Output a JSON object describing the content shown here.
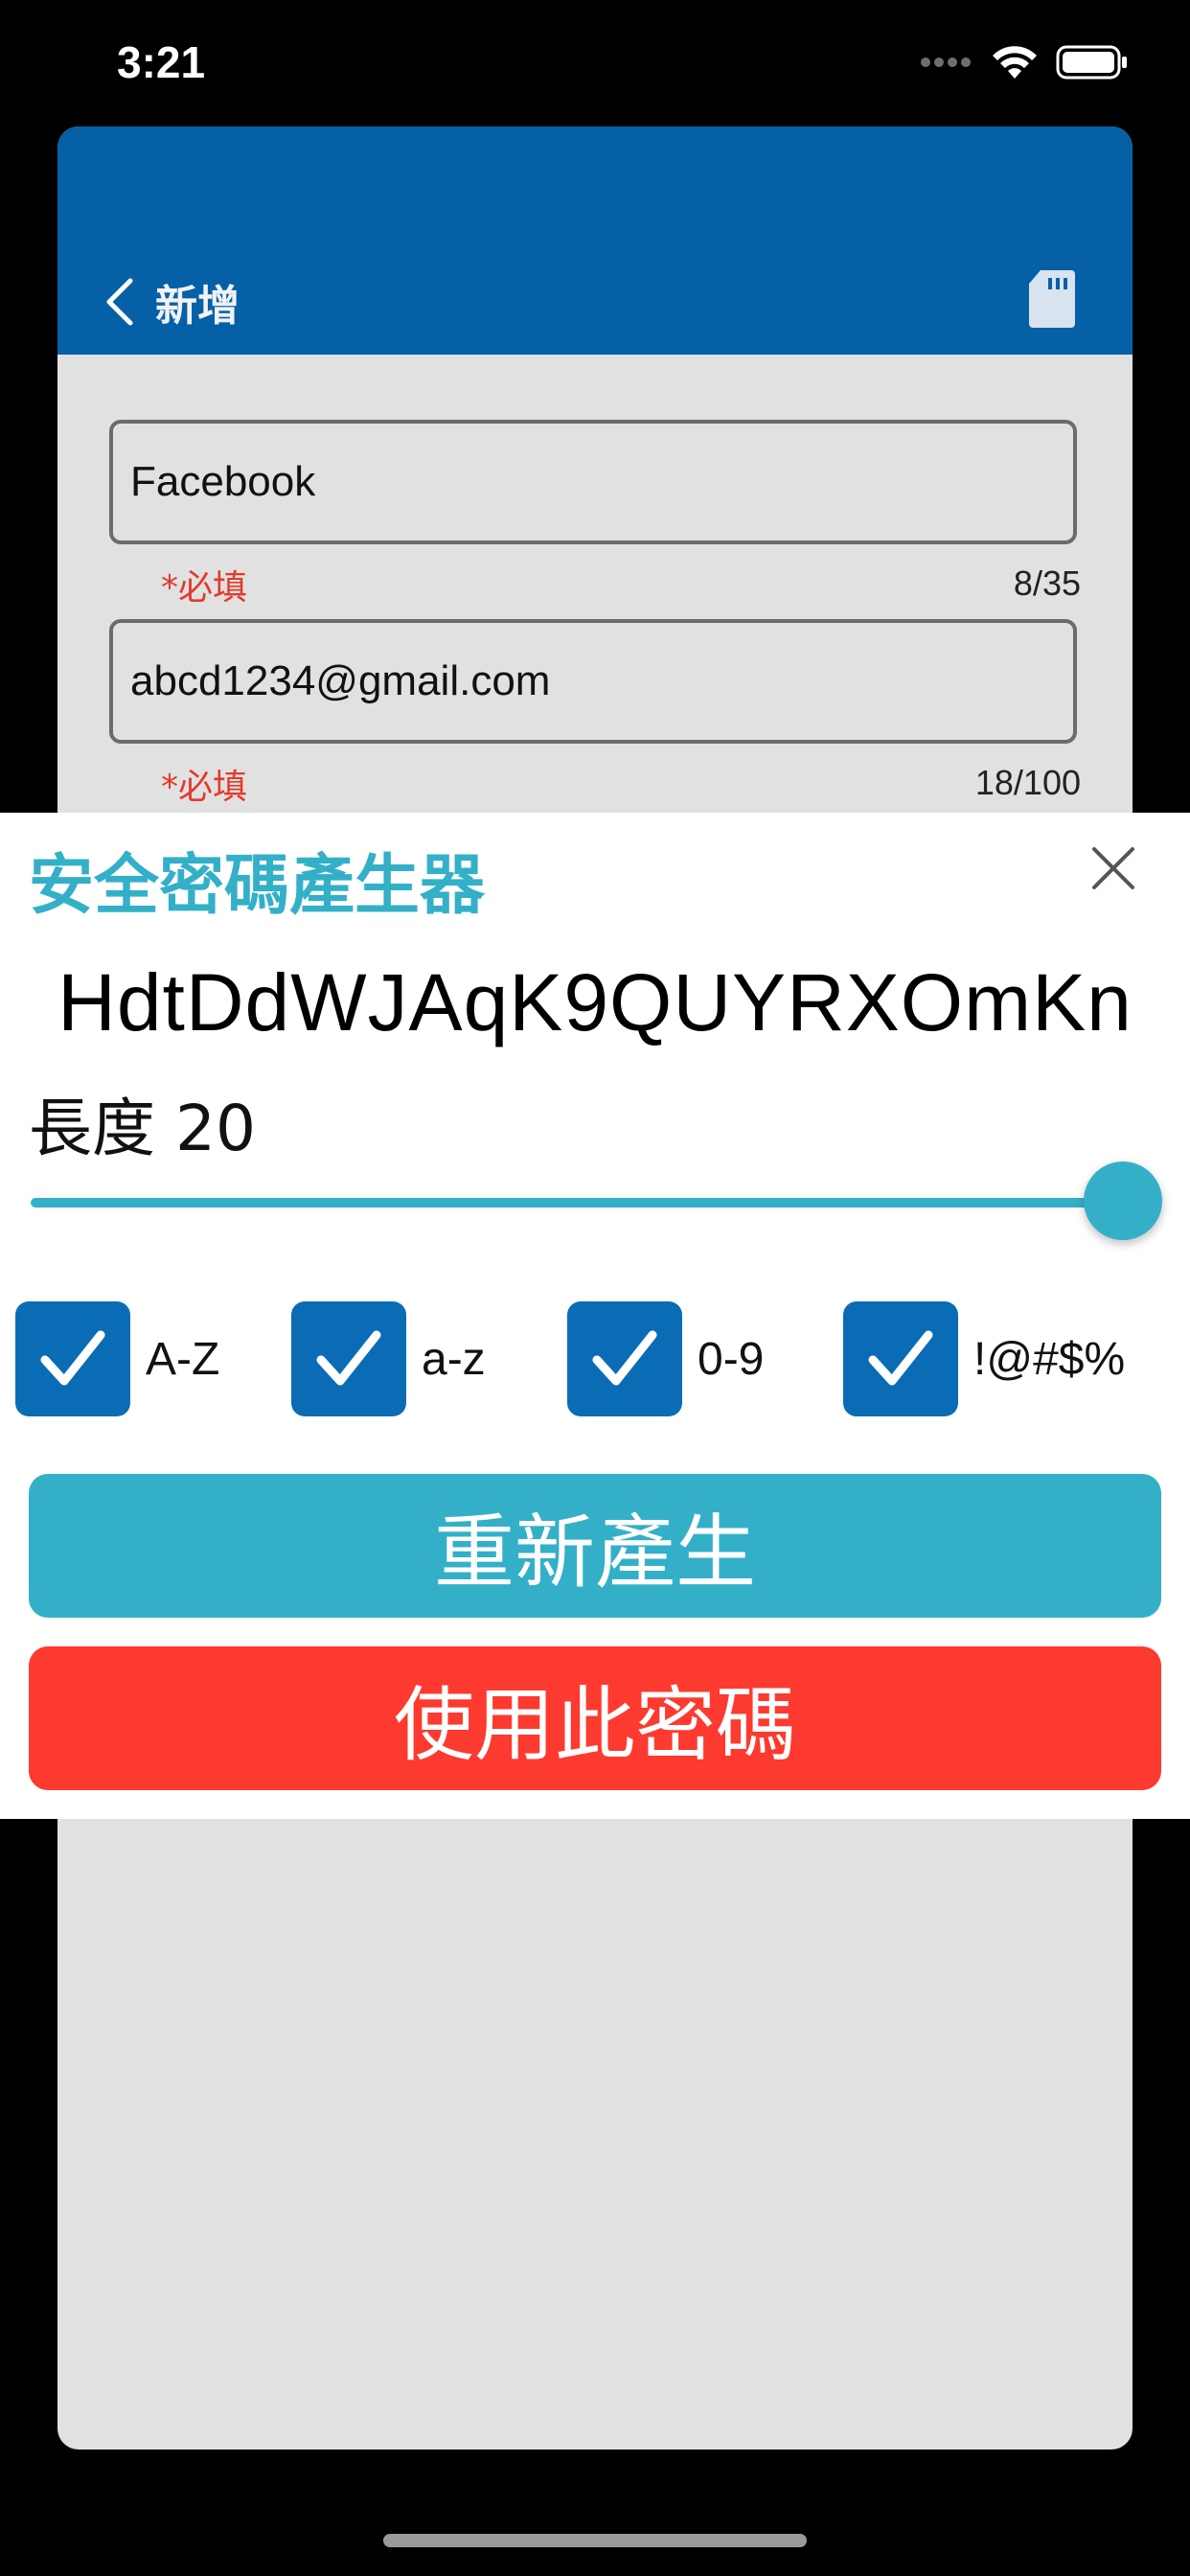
{
  "status_bar": {
    "time": "3:21",
    "icons": [
      "signal-dots-icon",
      "wifi-icon",
      "battery-icon"
    ]
  },
  "header": {
    "back_label": "新增",
    "back_icon": "chevron-left-icon",
    "right_icon": "sd-card-icon",
    "background_color": "#0660a6"
  },
  "form": {
    "fields": [
      {
        "value": "Facebook",
        "required_label": "*必填",
        "counter": "8/35"
      },
      {
        "value": "abcd1234@gmail.com",
        "required_label": "*必填",
        "counter": "18/100"
      }
    ]
  },
  "generator": {
    "title": "安全密碼產生器",
    "close_icon": "close-icon",
    "password": "HdtDdWJAqK9QUYRXOmKn",
    "length_label": "長度 20",
    "length_slider_fraction": 1.0,
    "options": [
      {
        "label": "A-Z",
        "checked": true
      },
      {
        "label": "a-z",
        "checked": true
      },
      {
        "label": "0-9",
        "checked": true
      },
      {
        "label": "!@#$%",
        "checked": true
      }
    ],
    "regenerate_label": "重新產生",
    "use_label": "使用此密碼",
    "accent_color": "#33b0c8",
    "danger_color": "#fd3a2f",
    "checkbox_color": "#0b6cb6"
  }
}
